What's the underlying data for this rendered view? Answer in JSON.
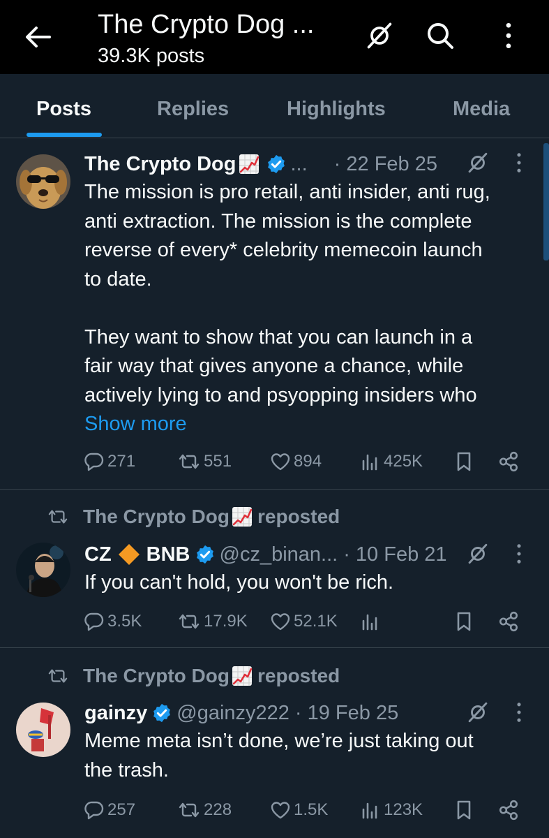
{
  "header": {
    "title": "The Crypto Dog ...",
    "subtitle": "39.3K posts"
  },
  "tabs": [
    "Posts",
    "Replies",
    "Highlights",
    "Media"
  ],
  "posts": [
    {
      "author": "The Crypto Dog",
      "handle": "...",
      "date": "· 22 Feb 25",
      "body_lines": [
        "The mission is pro retail, anti insider, anti rug,",
        "anti extraction. The mission is the complete",
        "reverse of every* celebrity memecoin launch",
        "to date.",
        "",
        "They want to show that you can launch in a",
        "fair way that gives anyone a chance, while",
        "actively lying to and psyopping insiders who"
      ],
      "show_more": "Show more",
      "replies": "271",
      "reposts": "551",
      "likes": "894",
      "views": "425K"
    },
    {
      "reposted_by": "The Crypto Dog",
      "reposted_label": "reposted",
      "author_a": "CZ",
      "author_b": "BNB",
      "handle": "@cz_binan...",
      "date": "· 10 Feb 21",
      "body": "If you can't hold, you won't be rich.",
      "replies": "3.5K",
      "reposts": "17.9K",
      "likes": "52.1K",
      "views": ""
    },
    {
      "reposted_by": "The Crypto Dog",
      "reposted_label": "reposted",
      "author": "gainzy",
      "handle": "@gainzy222",
      "date": "· 19 Feb 25",
      "body_lines": [
        "Meme meta isn’t done, we’re just taking out",
        "the trash."
      ],
      "replies": "257",
      "reposts": "228",
      "likes": "1.5K",
      "views": "123K"
    }
  ],
  "colors": {
    "background": "#15202b",
    "header_bg": "#000000",
    "accent": "#1d9bf0",
    "muted": "#8b98a5",
    "text": "#f7f9f9",
    "divider": "#38444d"
  },
  "icons": [
    "back-arrow-icon",
    "grok-icon",
    "search-icon",
    "more-vertical-icon",
    "verified-badge-icon",
    "chart-increasing-icon",
    "reply-icon",
    "repost-icon",
    "like-icon",
    "views-icon",
    "bookmark-icon",
    "share-icon",
    "diamond-icon"
  ]
}
